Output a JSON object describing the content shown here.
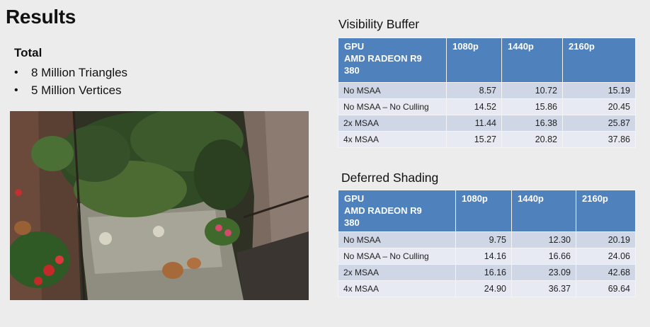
{
  "slide": {
    "title": "Results",
    "total_label": "Total",
    "bullets": [
      "8 Million Triangles",
      "5 Million Vertices"
    ],
    "bullet_glyph": "•"
  },
  "visibility_buffer": {
    "title": "Visibility Buffer",
    "headers": [
      "GPU",
      "AMD RADEON R9",
      "380",
      "1080p",
      "1440p",
      "2160p"
    ],
    "rows": [
      {
        "label": "No MSAA",
        "values": [
          "8.57",
          "10.72",
          "15.19"
        ]
      },
      {
        "label": "No MSAA – No Culling",
        "values": [
          "14.52",
          "15.86",
          "20.45"
        ]
      },
      {
        "label": "2x MSAA",
        "values": [
          "11.44",
          "16.38",
          "25.87"
        ]
      },
      {
        "label": "4x MSAA",
        "values": [
          "15.27",
          "20.82",
          "37.86"
        ]
      }
    ]
  },
  "deferred_shading": {
    "title": "Deferred Shading",
    "headers": [
      "GPU",
      "AMD RADEON R9",
      "380",
      "1080p",
      "1440p",
      "2160p"
    ],
    "rows": [
      {
        "label": "No MSAA",
        "values": [
          "9.75",
          "12.30",
          "20.19"
        ]
      },
      {
        "label": "No MSAA – No Culling",
        "values": [
          "14.16",
          "16.66",
          "24.06"
        ]
      },
      {
        "label": "2x MSAA",
        "values": [
          "16.16",
          "23.09",
          "42.68"
        ]
      },
      {
        "label": "4x MSAA",
        "values": [
          "24.90",
          "36.37",
          "69.64"
        ]
      }
    ]
  },
  "colors": {
    "header_blue": "#4f81bd",
    "row_odd": "#cfd6e6",
    "row_even": "#e7eaf2",
    "background": "#ececec"
  }
}
